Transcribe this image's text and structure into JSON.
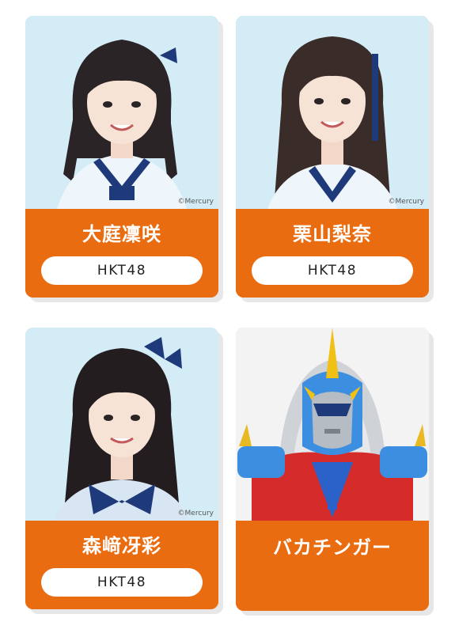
{
  "cards": [
    {
      "name": "大庭凜咲",
      "group": "HKT48",
      "copyright": "©Mercury"
    },
    {
      "name": "栗山梨奈",
      "group": "HKT48",
      "copyright": "©Mercury"
    },
    {
      "name": "森﨑冴彩",
      "group": "HKT48",
      "copyright": "©Mercury"
    },
    {
      "name": "バカチンガー"
    }
  ],
  "colors": {
    "card_orange": "#ea6c10",
    "photo_background": "#cdeaf6",
    "badge_background": "#ffffff"
  }
}
